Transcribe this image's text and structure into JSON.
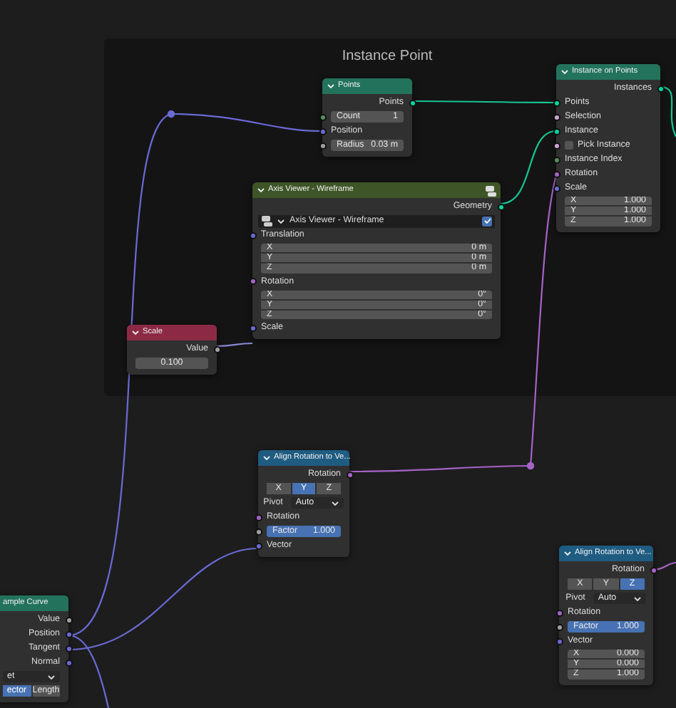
{
  "frame": {
    "label": "Instance Point"
  },
  "nodes": [
    {
      "title": "Points",
      "color": "#23735c",
      "rows": [
        {
          "kind": "output",
          "label": "Points",
          "color": "#00d6a3"
        },
        {
          "kind": "field",
          "label": "Count",
          "value": "1",
          "color": "#598c5c"
        },
        {
          "kind": "input",
          "label": "Position",
          "color": "#6a6ad6"
        },
        {
          "kind": "field",
          "label": "Radius",
          "value": "0.03 m",
          "color": "#a1a1a1"
        }
      ]
    },
    {
      "title": "Instance on Points",
      "color": "#23735c",
      "rows": [
        {
          "kind": "output",
          "label": "Instances",
          "color": "#00d6a3"
        },
        {
          "kind": "input",
          "label": "Points",
          "color": "#00d6a3"
        },
        {
          "kind": "input",
          "label": "Selection",
          "color": "#cca6d6"
        },
        {
          "kind": "input",
          "label": "Instance",
          "color": "#00d6a3"
        },
        {
          "kind": "checkbox",
          "label": "Pick Instance",
          "color": "#cca6d6",
          "checked": false
        },
        {
          "kind": "input",
          "label": "Instance Index",
          "color": "#598c5c"
        },
        {
          "kind": "input",
          "label": "Rotation",
          "color": "#a663c7"
        },
        {
          "kind": "input",
          "label": "Scale",
          "color": "#6a6ad6"
        },
        {
          "kind": "vector",
          "components": [
            {
              "label": "X",
              "value": "1.000"
            },
            {
              "label": "Y",
              "value": "1.000"
            },
            {
              "label": "Z",
              "value": "1.000"
            }
          ]
        }
      ]
    },
    {
      "title": "Axis Viewer - Wireframe",
      "color": "#3d5527",
      "rows": [
        {
          "kind": "output",
          "label": "Geometry",
          "color": "#00d6a3"
        },
        {
          "kind": "viewer",
          "label": "Axis Viewer - Wireframe",
          "checked": true
        },
        {
          "kind": "input",
          "label": "Translation",
          "color": "#6a6ad6"
        },
        {
          "kind": "vector",
          "components": [
            {
              "label": "X",
              "value": "0 m"
            },
            {
              "label": "Y",
              "value": "0 m"
            },
            {
              "label": "Z",
              "value": "0 m"
            }
          ]
        },
        {
          "kind": "input",
          "label": "Rotation",
          "color": "#a663c7"
        },
        {
          "kind": "vector",
          "components": [
            {
              "label": "X",
              "value": "0°"
            },
            {
              "label": "Y",
              "value": "0°"
            },
            {
              "label": "Z",
              "value": "0°"
            }
          ]
        },
        {
          "kind": "input",
          "label": "Scale",
          "color": "#6a6ad6"
        }
      ]
    },
    {
      "title": "Scale",
      "color": "#8c2a46",
      "rows": [
        {
          "kind": "output",
          "label": "Value",
          "color": "#a1a1a1"
        },
        {
          "kind": "field",
          "value": "0.100"
        }
      ]
    },
    {
      "title": "Align Rotation to Ve...",
      "color": "#1f5c82",
      "rows": [
        {
          "kind": "output",
          "label": "Rotation",
          "color": "#a663c7"
        },
        {
          "kind": "toggle",
          "options": [
            {
              "label": "X",
              "selected": false
            },
            {
              "label": "Y",
              "selected": true
            },
            {
              "label": "Z",
              "selected": false
            }
          ]
        },
        {
          "kind": "dropdown",
          "label": "Pivot",
          "value": "Auto"
        },
        {
          "kind": "input",
          "label": "Rotation",
          "color": "#a663c7"
        },
        {
          "kind": "slider",
          "label": "Factor",
          "value": "1.000",
          "color": "#a1a1a1",
          "level": 1
        },
        {
          "kind": "input",
          "label": "Vector",
          "color": "#6a6ad6"
        }
      ]
    },
    {
      "title": "ample Curve",
      "color": "#23735c",
      "rows": [
        {
          "kind": "output",
          "label": "Value",
          "color": "#a1a1a1"
        },
        {
          "kind": "output",
          "label": "Position",
          "color": "#6a6ad6"
        },
        {
          "kind": "output",
          "label": "Tangent",
          "color": "#6a6ad6"
        },
        {
          "kind": "output",
          "label": "Normal",
          "color": "#6a6ad6"
        },
        {
          "kind": "dropdown",
          "value": "et"
        },
        {
          "kind": "toggle",
          "options": [
            {
              "label": "ector",
              "selected": true
            },
            {
              "label": "Length",
              "selected": false
            }
          ]
        }
      ]
    },
    {
      "title": "Align Rotation to Ve...",
      "color": "#1f5c82",
      "rows": [
        {
          "kind": "output",
          "label": "Rotation",
          "color": "#a663c7"
        },
        {
          "kind": "toggle",
          "options": [
            {
              "label": "X",
              "selected": false
            },
            {
              "label": "Y",
              "selected": false
            },
            {
              "label": "Z",
              "selected": true
            }
          ]
        },
        {
          "kind": "dropdown",
          "label": "Pivot",
          "value": "Auto"
        },
        {
          "kind": "input",
          "label": "Rotation",
          "color": "#a663c7"
        },
        {
          "kind": "slider",
          "label": "Factor",
          "value": "1.000",
          "color": "#a1a1a1",
          "level": 1
        },
        {
          "kind": "input",
          "label": "Vector",
          "color": "#6a6ad6"
        },
        {
          "kind": "vector",
          "components": [
            {
              "label": "X",
              "value": "0.000"
            },
            {
              "label": "Y",
              "value": "0.000"
            },
            {
              "label": "Z",
              "value": "1.000"
            }
          ]
        }
      ]
    }
  ]
}
